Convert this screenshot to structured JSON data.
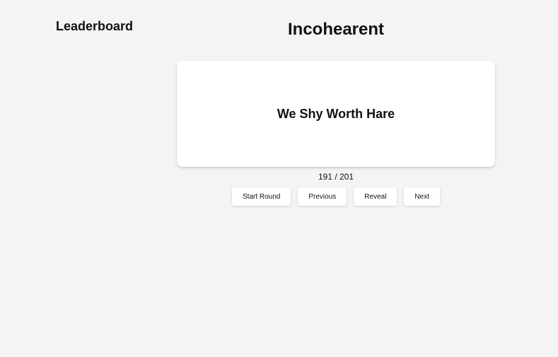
{
  "sidebar": {
    "title": "Leaderboard"
  },
  "main": {
    "title": "Incohearent",
    "card": {
      "phrase": "We Shy Worth Hare"
    },
    "counter": "191 / 201",
    "buttons": {
      "start_round": "Start Round",
      "previous": "Previous",
      "reveal": "Reveal",
      "next": "Next"
    }
  }
}
